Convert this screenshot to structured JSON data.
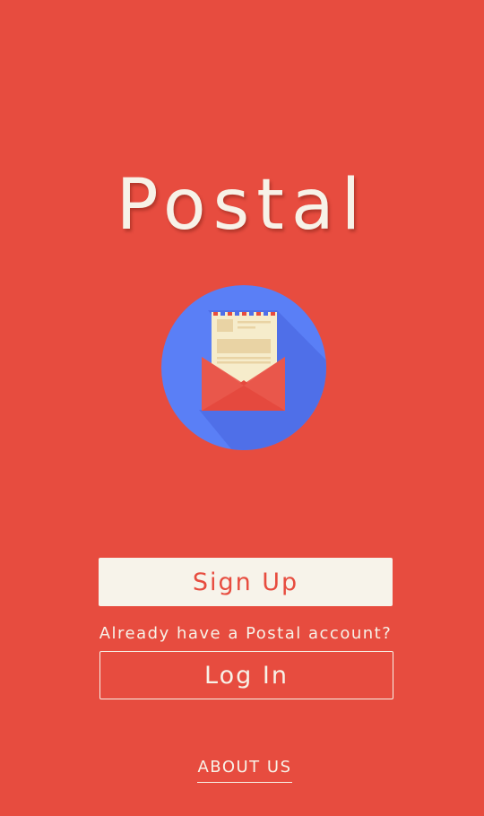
{
  "app": {
    "title": "Postal"
  },
  "logo": {
    "icon": "envelope-letter-icon"
  },
  "actions": {
    "signup_label": "Sign Up",
    "account_prompt": "Already have a Postal account?",
    "login_label": "Log In",
    "about_label": "ABOUT US"
  },
  "colors": {
    "background": "#e74c3f",
    "circle": "#5b7ff5",
    "text_light": "#f7f2e8",
    "envelope": "#e74c3f"
  }
}
